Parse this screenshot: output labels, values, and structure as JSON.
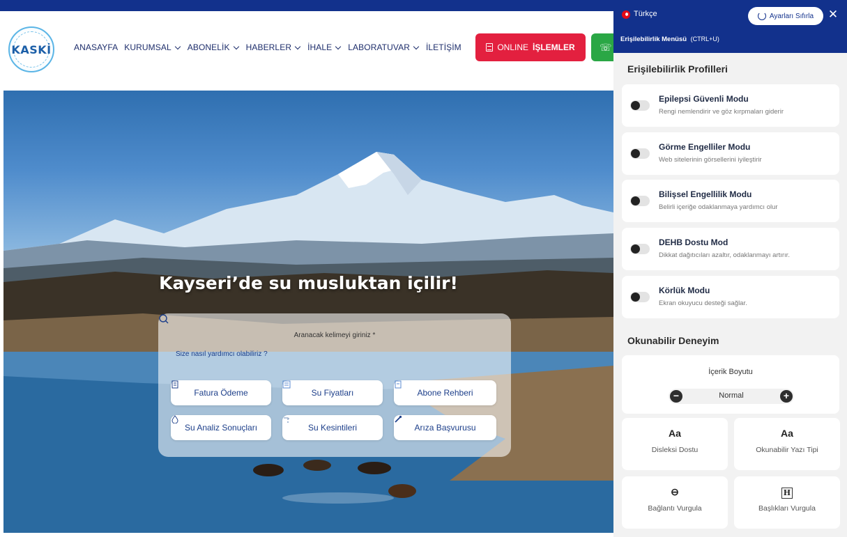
{
  "header": {
    "logo_text": "KASKİ",
    "nav": [
      {
        "label": "ANASAYFA",
        "has_dropdown": false
      },
      {
        "label": "KURUMSAL",
        "has_dropdown": true
      },
      {
        "label": "ABONELİK",
        "has_dropdown": true
      },
      {
        "label": "HABERLER",
        "has_dropdown": true
      },
      {
        "label": "İHALE",
        "has_dropdown": true
      },
      {
        "label": "LABORATUVAR",
        "has_dropdown": true
      },
      {
        "label": "İLETİŞİM",
        "has_dropdown": false
      }
    ],
    "online_button": {
      "prefix": "ONLINE",
      "bold": "İŞLEMLER"
    },
    "phone_icon": "phone-icon"
  },
  "hero": {
    "title": "Kayseri’de su musluktan içilir!",
    "search_label": "Aranacak kelimeyi giriniz *",
    "search_placeholder": "Size nasıl yardımcı olabiliriz ?",
    "quick_links": [
      {
        "label": "Fatura Ödeme",
        "icon": "invoice-icon"
      },
      {
        "label": "Su Fiyatları",
        "icon": "price-list-icon"
      },
      {
        "label": "Abone Rehberi",
        "icon": "guide-icon"
      },
      {
        "label": "Su Analiz Sonuçları",
        "icon": "water-drop-icon"
      },
      {
        "label": "Su Kesintileri",
        "icon": "faucet-icon"
      },
      {
        "label": "Arıza Başvurusu",
        "icon": "wrench-icon"
      }
    ]
  },
  "accessibility": {
    "language": "Türkçe",
    "reset_label": "Ayarları Sıfırla",
    "menu_title": "Erişilebilirlik Menüsü",
    "menu_shortcut": "(CTRL+U)",
    "profiles_title": "Erişilebilirlik Profilleri",
    "profiles": [
      {
        "title": "Epilepsi Güvenli Modu",
        "desc": "Rengi nemlendirir ve göz kırpmaları giderir",
        "enabled": false
      },
      {
        "title": "Görme Engelliler Modu",
        "desc": "Web sitelerinin görsellerini iyileştirir",
        "enabled": false
      },
      {
        "title": "Bilişsel Engellilik Modu",
        "desc": "Belirli içeriğe odaklanmaya yardımcı olur",
        "enabled": false
      },
      {
        "title": "DEHB Dostu Mod",
        "desc": "Dikkat dağıtıcıları azaltır, odaklanmayı artırır.",
        "enabled": false
      },
      {
        "title": "Körlük Modu",
        "desc": "Ekran okuyucu desteği sağlar.",
        "enabled": false
      }
    ],
    "readable_title": "Okunabilir Deneyim",
    "content_size_label": "İçerik Boyutu",
    "content_size_value": "Normal",
    "tiles": [
      {
        "icon_text": "Aa",
        "label": "Disleksi Dostu"
      },
      {
        "icon_text": "Aa",
        "label": "Okunabilir Yazı Tipi"
      },
      {
        "icon_text": "⊖",
        "label": "Bağlantı Vurgula"
      },
      {
        "icon_text": "H",
        "label": "Başlıkları Vurgula"
      }
    ]
  },
  "colors": {
    "brand_navy": "#12318c",
    "online_red": "#e3203f",
    "phone_green": "#2aa745"
  }
}
